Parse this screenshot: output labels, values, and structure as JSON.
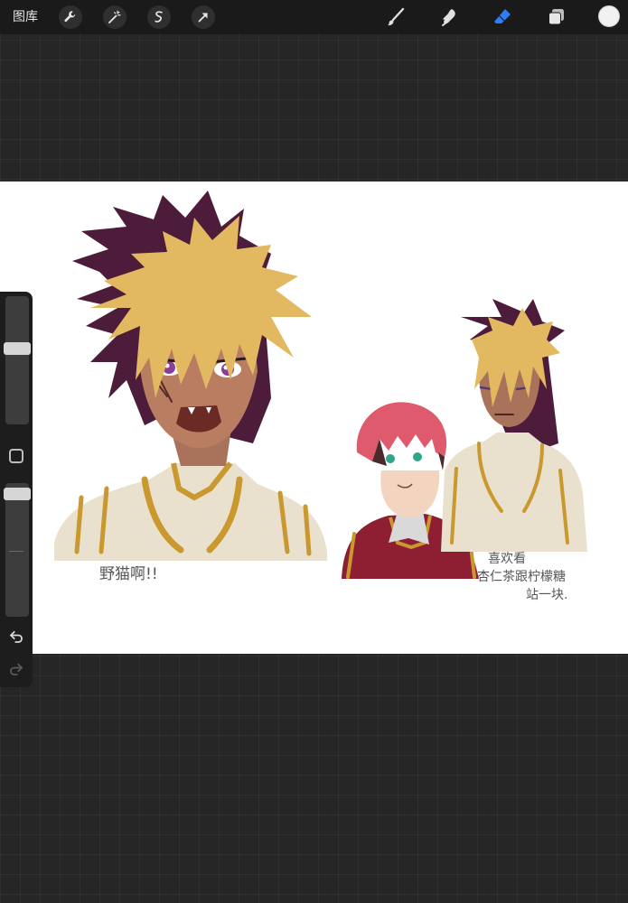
{
  "topbar": {
    "gallery_label": "图库",
    "left_tools": [
      {
        "name": "wrench-icon"
      },
      {
        "name": "magic-wand-icon"
      },
      {
        "name": "selection-icon"
      },
      {
        "name": "transform-arrow-icon"
      }
    ],
    "right_tools": [
      {
        "name": "brush-icon"
      },
      {
        "name": "smudge-icon"
      },
      {
        "name": "eraser-icon",
        "active": true
      },
      {
        "name": "layers-icon"
      }
    ],
    "current_color": "#f1f1f1",
    "accent_color": "#2f7df6"
  },
  "canvas": {
    "caption_left": "野猫啊!!",
    "caption_right_line1": "喜欢看",
    "caption_right_line2": "杏仁茶跟柠檬糖",
    "caption_right_line3": "站一块."
  },
  "sidebar": {
    "brush_size_level": 0.6,
    "opacity_level": 1.0
  }
}
